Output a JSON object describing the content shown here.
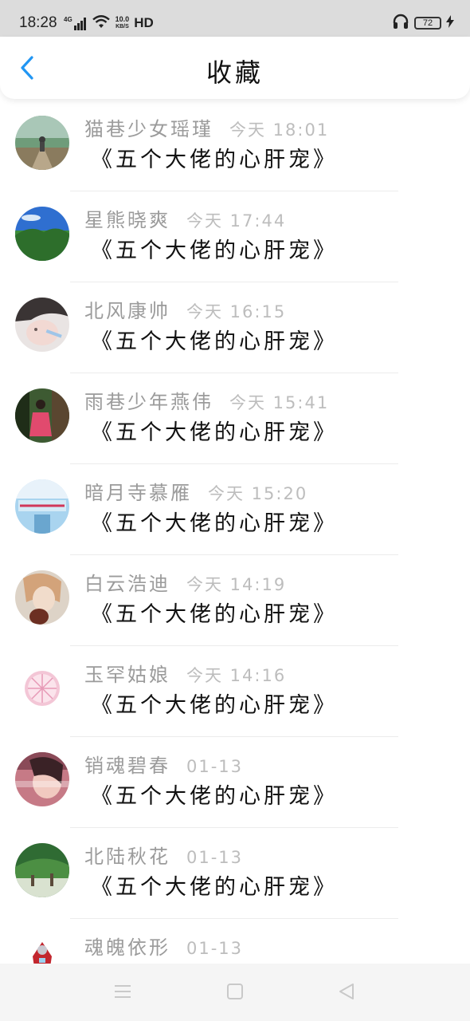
{
  "status_bar": {
    "time": "18:28",
    "network": "4G",
    "speed_value": "10.0",
    "speed_unit": "KB/S",
    "hd": "HD",
    "battery": "72"
  },
  "header": {
    "title": "收藏"
  },
  "items": [
    {
      "name": "猫巷少女瑶瑾",
      "time": "今天 18:01",
      "book": "《五个大佬的心肝宠》"
    },
    {
      "name": "星熊晓爽",
      "time": "今天 17:44",
      "book": "《五个大佬的心肝宠》"
    },
    {
      "name": "北风康帅",
      "time": "今天 16:15",
      "book": "《五个大佬的心肝宠》"
    },
    {
      "name": "雨巷少年燕伟",
      "time": "今天 15:41",
      "book": "《五个大佬的心肝宠》"
    },
    {
      "name": "暗月寺慕雁",
      "time": "今天 15:20",
      "book": "《五个大佬的心肝宠》"
    },
    {
      "name": "白云浩迪",
      "time": "今天 14:19",
      "book": "《五个大佬的心肝宠》"
    },
    {
      "name": "玉罕姑娘",
      "time": "今天 14:16",
      "book": "《五个大佬的心肝宠》"
    },
    {
      "name": "销魂碧春",
      "time": "01-13",
      "book": "《五个大佬的心肝宠》"
    },
    {
      "name": "北陆秋花",
      "time": "01-13",
      "book": "《五个大佬的心肝宠》"
    },
    {
      "name": "魂魄依形",
      "time": "01-13",
      "book": ""
    }
  ],
  "colors": {
    "accent": "#2196f3",
    "name_text": "#9b9b9b",
    "time_text": "#bdbdbd"
  }
}
